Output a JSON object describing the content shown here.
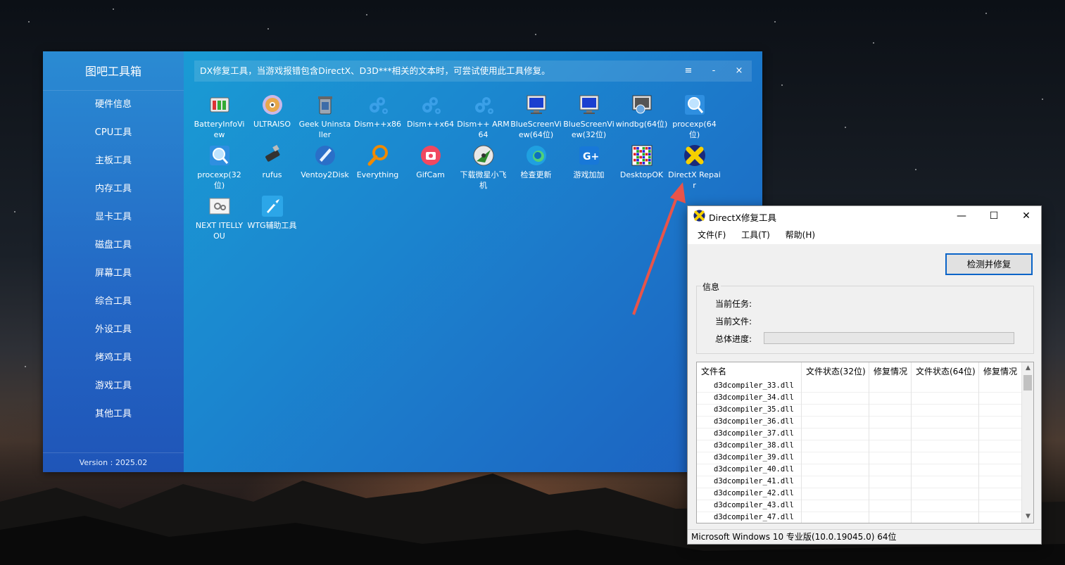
{
  "toolbox": {
    "title": "图吧工具箱",
    "nav": [
      "硬件信息",
      "CPU工具",
      "主板工具",
      "内存工具",
      "显卡工具",
      "磁盘工具",
      "屏幕工具",
      "综合工具",
      "外设工具",
      "烤鸡工具",
      "游戏工具",
      "其他工具"
    ],
    "version": "Version : 2025.02",
    "description": "DX修复工具，当游戏报错包含DirectX、D3D***相关的文本时，可尝试使用此工具修复。",
    "controls": {
      "menu": "≡",
      "minimize": "-",
      "close": "×"
    },
    "apps": [
      {
        "label": "BatteryInfoView",
        "icon": "battery-icon"
      },
      {
        "label": "ULTRAISO",
        "icon": "disc-icon"
      },
      {
        "label": "Geek Uninstaller",
        "icon": "trash-icon"
      },
      {
        "label": "Dism++x86",
        "icon": "gear-icon"
      },
      {
        "label": "Dism++x64",
        "icon": "gear-icon"
      },
      {
        "label": "Dism++ ARM64",
        "icon": "gear-icon"
      },
      {
        "label": "BlueScreenView(64位)",
        "icon": "monitor-icon"
      },
      {
        "label": "BlueScreenView(32位)",
        "icon": "monitor-icon"
      },
      {
        "label": "windbg(64位)",
        "icon": "debugger-icon"
      },
      {
        "label": "procexp(64位)",
        "icon": "magnifier-icon"
      },
      {
        "label": "procexp(32位)",
        "icon": "magnifier-icon"
      },
      {
        "label": "rufus",
        "icon": "usb-icon"
      },
      {
        "label": "Ventoy2Disk",
        "icon": "ventoy-icon"
      },
      {
        "label": "Everything",
        "icon": "search-icon"
      },
      {
        "label": "GifCam",
        "icon": "camera-icon"
      },
      {
        "label": "下载微星小飞机",
        "icon": "afterburner-icon"
      },
      {
        "label": "检查更新",
        "icon": "edge-icon"
      },
      {
        "label": "游戏加加",
        "icon": "gameplus-icon"
      },
      {
        "label": "DesktopOK",
        "icon": "grid-icon"
      },
      {
        "label": "DirectX Repair",
        "icon": "directx-icon"
      },
      {
        "label": "NEXT ITELLYOU",
        "icon": "settings-window-icon"
      },
      {
        "label": "WTG辅助工具",
        "icon": "rocket-icon"
      }
    ]
  },
  "dx": {
    "title": "DirectX修复工具",
    "menu": [
      "文件(F)",
      "工具(T)",
      "帮助(H)"
    ],
    "fix_button": "检测并修复",
    "info_caption": "信息",
    "current_task_label": "当前任务:",
    "current_file_label": "当前文件:",
    "total_progress_label": "总体进度:",
    "progress": 0,
    "columns": [
      "文件名",
      "文件状态(32位)",
      "修复情况",
      "文件状态(64位)",
      "修复情况"
    ],
    "files": [
      "d3dcompiler_33.dll",
      "d3dcompiler_34.dll",
      "d3dcompiler_35.dll",
      "d3dcompiler_36.dll",
      "d3dcompiler_37.dll",
      "d3dcompiler_38.dll",
      "d3dcompiler_39.dll",
      "d3dcompiler_40.dll",
      "d3dcompiler_41.dll",
      "d3dcompiler_42.dll",
      "d3dcompiler_43.dll",
      "d3dcompiler_47.dll"
    ],
    "status": "Microsoft Windows 10 专业版(10.0.19045.0) 64位",
    "controls": {
      "minimize": "—",
      "maximize": "☐",
      "close": "✕"
    },
    "scroll_up": "▲",
    "scroll_down": "▼"
  },
  "colors": {
    "accent": "#0a64c8",
    "arrow": "#e8544a"
  }
}
